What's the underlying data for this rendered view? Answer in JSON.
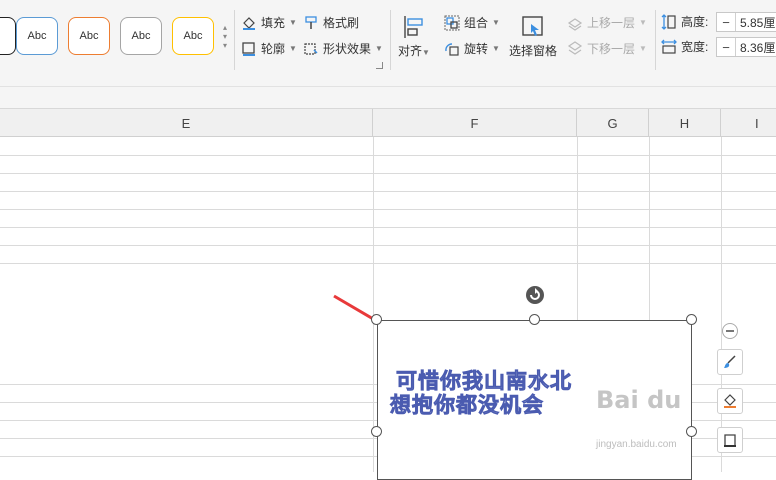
{
  "ribbon": {
    "style_swatches": [
      {
        "label": "Abc",
        "border": "#5b9bd5"
      },
      {
        "label": "Abc",
        "border": "#ed7d31"
      },
      {
        "label": "Abc",
        "border": "#a5a5a5"
      },
      {
        "label": "Abc",
        "border": "#ffc000"
      }
    ],
    "fill_label": "填充",
    "outline_label": "轮廓",
    "format_painter_label": "格式刷",
    "shape_effects_label": "形状效果",
    "align_label": "对齐",
    "group_label": "组合",
    "rotate_label": "旋转",
    "selection_pane_label": "选择窗格",
    "bring_forward_label": "上移一层",
    "send_backward_label": "下移一层",
    "height_label": "高度:",
    "height_value": "5.85厘",
    "width_label": "宽度:",
    "width_value": "8.36厘"
  },
  "columns": [
    "E",
    "F",
    "G",
    "H",
    "I"
  ],
  "textbox": {
    "line1": "可惜你我山南水北",
    "line2": "想抱你都没机会"
  },
  "watermark": {
    "brand": "Bai du",
    "sub": "jingyan.baidu.com"
  },
  "colors": {
    "arrow": "#e8393a",
    "wordart_fill": "#d6dbef",
    "wordart_stroke": "#4a5bb0",
    "accent_blue": "#3c8fe0"
  }
}
